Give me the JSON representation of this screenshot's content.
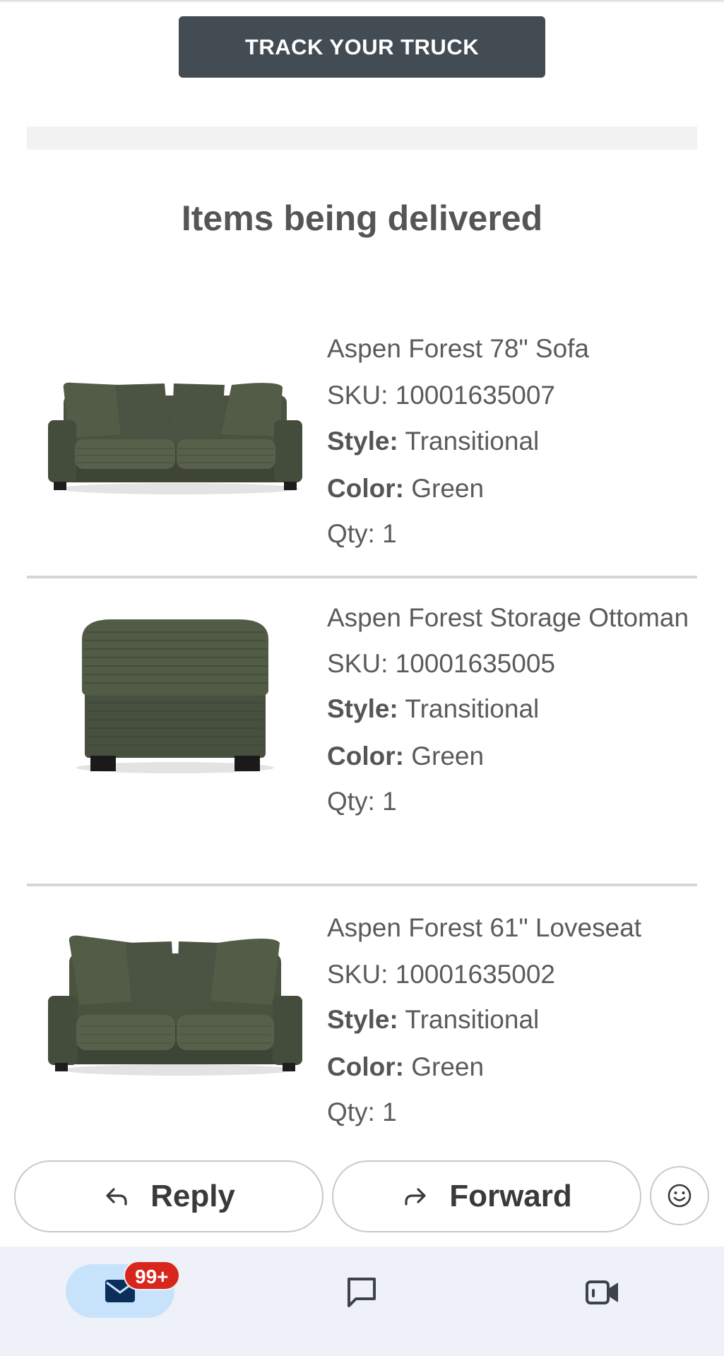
{
  "header": {
    "track_button_label": "TRACK YOUR TRUCK"
  },
  "section": {
    "title": "Items being delivered"
  },
  "items": [
    {
      "name": "Aspen Forest 78\" Sofa",
      "sku": "SKU: 10001635007",
      "style_label": "Style:",
      "style_value": " Transitional",
      "color_label": "Color:",
      "color_value": " Green",
      "qty": "Qty: 1"
    },
    {
      "name": "Aspen Forest Storage Ottoman",
      "sku": "SKU: 10001635005",
      "style_label": "Style:",
      "style_value": " Transitional",
      "color_label": "Color:",
      "color_value": " Green",
      "qty": "Qty: 1"
    },
    {
      "name": "Aspen Forest 61\" Loveseat",
      "sku": "SKU: 10001635002",
      "style_label": "Style:",
      "style_value": " Transitional",
      "color_label": "Color:",
      "color_value": " Green",
      "qty": "Qty: 1"
    }
  ],
  "actions": {
    "reply_label": "Reply",
    "forward_label": "Forward",
    "emoji_icon": "smiley-icon"
  },
  "nav": {
    "mail_badge": "99+",
    "mail_icon": "mail-icon",
    "chat_icon": "chat-icon",
    "video_icon": "video-icon"
  },
  "colors": {
    "button_dark": "#434c53",
    "badge_red": "#d9261c",
    "nav_bg": "#eef1f8",
    "nav_active": "#c7e2fb",
    "fabric_green": "#4a5340"
  }
}
